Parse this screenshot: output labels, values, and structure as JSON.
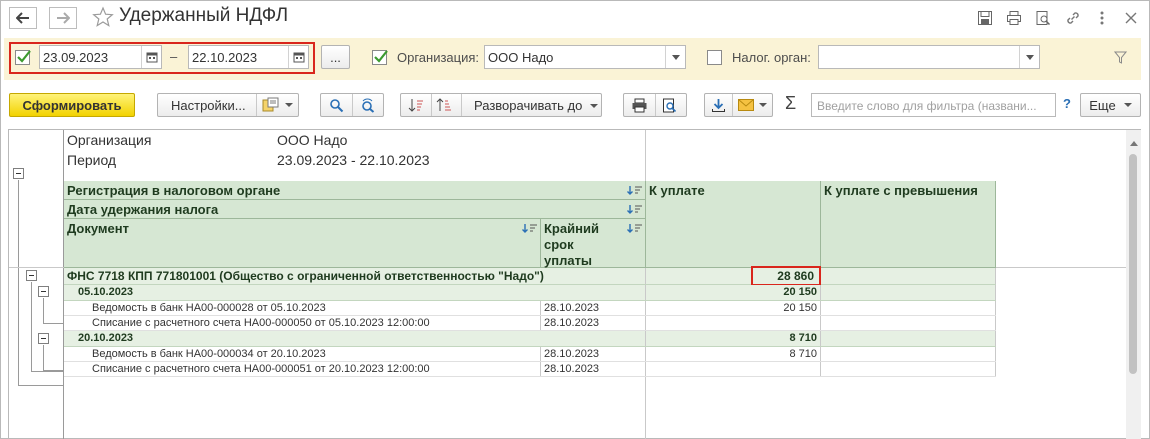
{
  "window": {
    "title": "Удержанный НДФЛ"
  },
  "filters": {
    "date_from": "23.09.2023",
    "date_dash": "–",
    "date_to": "22.10.2023",
    "ellipsis": "...",
    "org_label": "Организация:",
    "org_value": "ООО Надо",
    "tax_label": "Налог. орган:",
    "tax_value": ""
  },
  "toolbar": {
    "generate": "Сформировать",
    "settings": "Настройки...",
    "expand_to": "Разворачивать до",
    "search_placeholder": "Введите слово для фильтра (названи...",
    "help": "?",
    "more": "Еще"
  },
  "report": {
    "meta": [
      {
        "label": "Организация",
        "value": "ООО Надо"
      },
      {
        "label": "Период",
        "value": "23.09.2023 - 22.10.2023"
      }
    ],
    "headers": {
      "registration": "Регистрация в налоговом органе",
      "withhold_date": "Дата удержания налога",
      "document": "Документ",
      "deadline": "Крайний срок уплаты",
      "deadline_lines": [
        "Крайний",
        "срок",
        "уплаты"
      ],
      "to_pay": "К уплате",
      "to_pay_excess": "К уплате с превышения"
    },
    "group": {
      "name": "ФНС 7718 КПП 771801001 (Общество с ограниченной ответственностью \"Надо\")",
      "total": "28 860"
    },
    "subgroups": [
      {
        "date": "05.10.2023",
        "total": "20 150",
        "rows": [
          {
            "doc": "Ведомость в банк НА00-000028 от 05.10.2023",
            "deadline": "28.10.2023",
            "amount": "20 150"
          },
          {
            "doc": "Списание с расчетного счета НА00-000050 от 05.10.2023 12:00:00",
            "deadline": "28.10.2023",
            "amount": ""
          }
        ]
      },
      {
        "date": "20.10.2023",
        "total": "8 710",
        "rows": [
          {
            "doc": "Ведомость в банк НА00-000034 от 20.10.2023",
            "deadline": "28.10.2023",
            "amount": "8 710"
          },
          {
            "doc": "Списание с расчетного счета НА00-000051 от 20.10.2023 12:00:00",
            "deadline": "28.10.2023",
            "amount": ""
          }
        ]
      }
    ]
  },
  "colors": {
    "filter_bg": "#faf3d6",
    "header_bg": "#d6e7d3",
    "group_bg": "#e6f0e3",
    "highlight": "#d9261c",
    "primary_button": "#f2d200"
  }
}
